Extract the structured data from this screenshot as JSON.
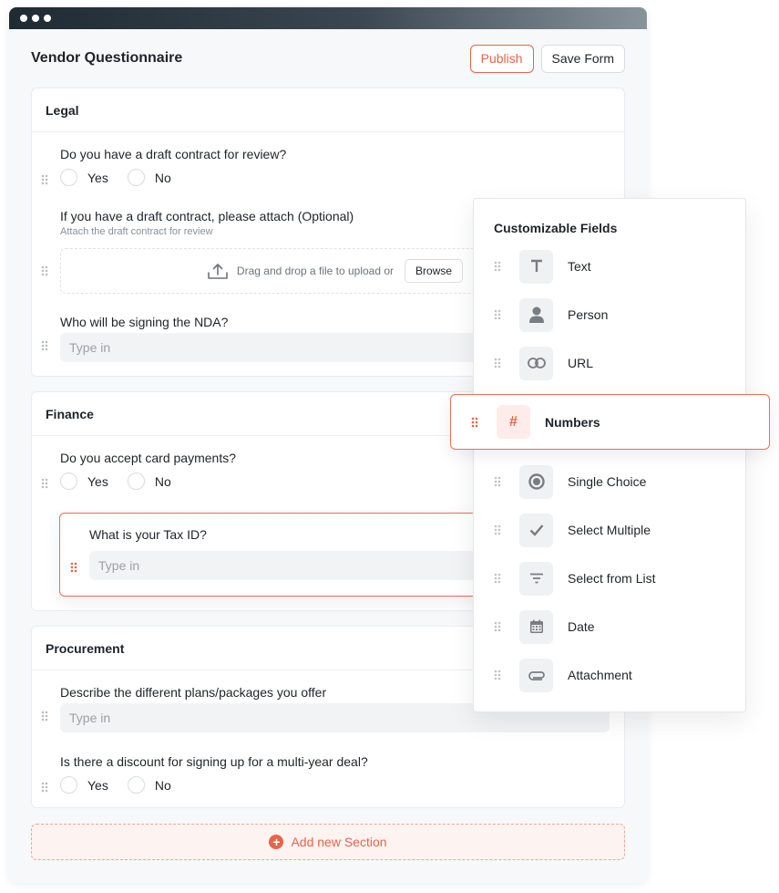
{
  "form": {
    "title": "Vendor Questionnaire",
    "publish_label": "Publish",
    "save_label": "Save Form"
  },
  "sections": {
    "legal": {
      "title": "Legal",
      "q1": {
        "label": "Do you have a draft contract for review?",
        "yes": "Yes",
        "no": "No"
      },
      "q2": {
        "label": "If you have a draft contract, please attach (Optional)",
        "help": "Attach the draft contract for review",
        "dropzone_text": "Drag and drop a file to upload or",
        "browse_label": "Browse"
      },
      "q3": {
        "label": "Who will be signing the NDA?",
        "placeholder": "Type in"
      }
    },
    "finance": {
      "title": "Finance",
      "q1": {
        "label": "Do you accept card payments?",
        "yes": "Yes",
        "no": "No"
      },
      "dragged": {
        "label": "What is your Tax ID?",
        "placeholder": "Type in"
      }
    },
    "procurement": {
      "title": "Procurement",
      "q1": {
        "label": "Describe the different plans/packages you offer",
        "placeholder": "Type in"
      },
      "q2": {
        "label": "Is there a discount for signing up for a multi-year deal?",
        "yes": "Yes",
        "no": "No"
      }
    }
  },
  "add_section_label": "Add new Section",
  "panel": {
    "title": "Customizable Fields",
    "fields": [
      {
        "label": "Text",
        "icon": "text-icon"
      },
      {
        "label": "Person",
        "icon": "person-icon"
      },
      {
        "label": "URL",
        "icon": "link-icon"
      },
      {
        "label": "Numbers",
        "icon": "hash-icon",
        "dragging": true
      },
      {
        "label": "Single Choice",
        "icon": "radio-icon"
      },
      {
        "label": "Select Multiple",
        "icon": "check-icon"
      },
      {
        "label": "Select from List",
        "icon": "filter-list-icon"
      },
      {
        "label": "Date",
        "icon": "calendar-icon"
      },
      {
        "label": "Attachment",
        "icon": "paperclip-icon"
      }
    ]
  },
  "colors": {
    "accent": "#e8644a",
    "accent_light": "#fdecea",
    "panel_bg": "#f7f8f9"
  }
}
